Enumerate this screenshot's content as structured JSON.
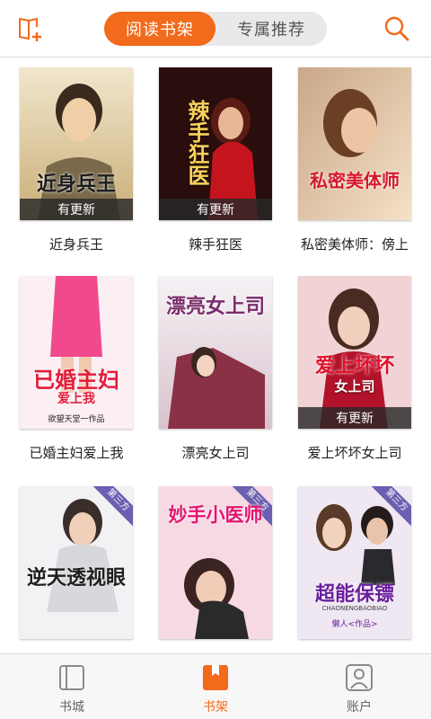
{
  "header": {
    "tabs": [
      {
        "label": "阅读书架",
        "active": true
      },
      {
        "label": "专属推荐",
        "active": false
      }
    ],
    "left_icon": "add-book-icon",
    "right_icon": "search-icon",
    "accent_color": "#f26a1b"
  },
  "books": [
    {
      "title": "近身兵王",
      "cover_text": "近身兵王",
      "badge": "有更新",
      "ribbon": ""
    },
    {
      "title": "辣手狂医",
      "cover_text": "辣手狂医",
      "badge": "有更新",
      "ribbon": ""
    },
    {
      "title": "私密美体师：傍上",
      "cover_text": "私密美体师",
      "badge": "",
      "ribbon": ""
    },
    {
      "title": "已婚主妇爱上我",
      "cover_text": "已婚主妇",
      "cover_sub": "爱上我",
      "author": "欲望天堂一作品",
      "badge": "",
      "ribbon": ""
    },
    {
      "title": "漂亮女上司",
      "cover_text": "漂亮女上司",
      "badge": "",
      "ribbon": ""
    },
    {
      "title": "爱上坏坏女上司",
      "cover_text": "爱上坏坏",
      "cover_sub": "女上司",
      "badge": "有更新",
      "ribbon": ""
    },
    {
      "title": "",
      "cover_text": "逆天透视眼",
      "badge": "",
      "ribbon": "第三方"
    },
    {
      "title": "",
      "cover_text": "妙手小医师",
      "badge": "",
      "ribbon": "第三方"
    },
    {
      "title": "",
      "cover_text": "超能保镖",
      "cover_sub": "CHAONENGBAOBIAO",
      "author": "懒人<作品>",
      "badge": "",
      "ribbon": "第三方"
    }
  ],
  "bottom_nav": [
    {
      "label": "书城",
      "icon": "bookstore-icon",
      "active": false
    },
    {
      "label": "书架",
      "icon": "bookshelf-icon",
      "active": true
    },
    {
      "label": "账户",
      "icon": "account-icon",
      "active": false
    }
  ]
}
